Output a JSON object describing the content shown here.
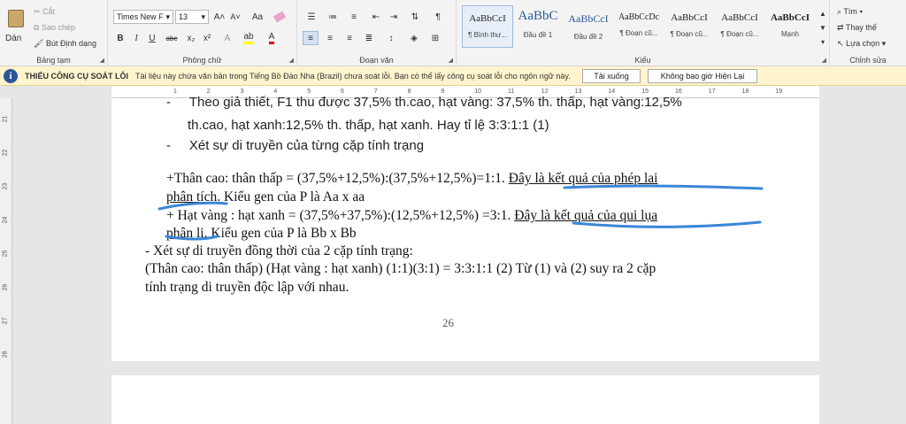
{
  "ribbon": {
    "clipboard": {
      "paste": "Dán",
      "cut": "Cắt",
      "copy": "Sao chép",
      "format_painter": "Bút Định dạng",
      "label": "Bảng tạm"
    },
    "font": {
      "name": "Times New F",
      "size": "13",
      "grow": "A˄",
      "shrink": "A˅",
      "case": "Aa",
      "bold": "B",
      "italic": "I",
      "underline": "U",
      "strike": "abc",
      "subscript": "x₂",
      "superscript": "x²",
      "label": "Phông chữ"
    },
    "paragraph": {
      "label": "Đoạn văn",
      "pilcrow": "¶"
    },
    "styles": {
      "label": "Kiểu",
      "items": [
        {
          "sample": "AaBbCcI",
          "name": "¶ Bình thư..."
        },
        {
          "sample": "AaBbC",
          "name": "Đầu đề 1"
        },
        {
          "sample": "AaBbCcI",
          "name": "Đầu đề 2"
        },
        {
          "sample": "AaBbCcDc",
          "name": "¶ Đoạn cũ..."
        },
        {
          "sample": "AaBbCcI",
          "name": "¶ Đoạn cũ..."
        },
        {
          "sample": "AaBbCcI",
          "name": "¶ Đoạn cũ..."
        },
        {
          "sample": "AaBbCcI",
          "name": "Mạnh"
        }
      ]
    },
    "editing": {
      "find": "Tìm",
      "replace": "Thay thế",
      "select": "Lựa chọn",
      "label": "Chỉnh sửa"
    }
  },
  "message_bar": {
    "title": "THIẾU CÔNG CỤ SOÁT LỖI",
    "text": "Tài liệu này chứa văn bản trong Tiếng Bồ Đào Nha (Brazil) chưa soát lỗi. Bạn có thể lấy công cụ soát lỗi cho ngôn ngữ này.",
    "download_btn": "Tải xuống",
    "dismiss_btn": "Không bao giờ Hiện Lại"
  },
  "ruler": {
    "h_ticks": [
      "1",
      "2",
      "3",
      "4",
      "5",
      "6",
      "7",
      "8",
      "9",
      "10",
      "11",
      "12",
      "13",
      "14",
      "15",
      "16",
      "17",
      "18",
      "19"
    ],
    "v_ticks": [
      "21",
      "22",
      "23",
      "24",
      "25",
      "26",
      "27",
      "28"
    ]
  },
  "document": {
    "lines": [
      "Theo giả thiết, F1 thu được 37,5% th.cao, hạt vàng: 37,5% th. thấp, hạt vàng:12,5%",
      "th.cao, hạt xanh:12,5% th. thấp, hạt  xanh. Hay tỉ lệ 3:3:1:1 (1)",
      "Xét sự di truyền của từng cặp tính trạng",
      "+Thân cao: thân thấp = (37,5%+12,5%):(37,5%+12,5%)=1:1.",
      "Đây là kết quả của phép lai",
      "phân tích",
      ". Kiểu gen của P là Aa x aa",
      "+ Hạt vàng : hạt xanh = (37,5%+37,5%):(12,5%+12,5%) =3:1.",
      "Đây là kết quả của qui lụa",
      "phân li",
      ". Kiểu gen của P là Bb x Bb",
      "- Xét sự di truyền đồng thời của 2 cặp tính trạng:",
      "(Thân cao: thân thấp) (Hạt vàng : hạt xanh)  (1:1)(3:1) = 3:3:1:1 (2) Từ (1) và (2) suy ra 2 cặp",
      "tính trạng di truyền độc lập với nhau."
    ],
    "bullet": "-",
    "page_number": "26"
  },
  "colors": {
    "annotation": "#3a86d8",
    "accent": "#2b579a"
  }
}
